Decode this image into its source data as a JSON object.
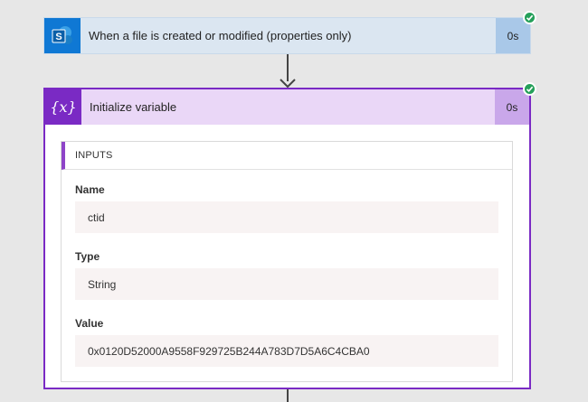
{
  "steps": [
    {
      "title": "When a file is created or modified (properties only)",
      "duration": "0s",
      "icon": "sharepoint-icon",
      "status": "succeeded"
    },
    {
      "title": "Initialize variable",
      "duration": "0s",
      "icon": "variable-icon",
      "status": "succeeded",
      "inputs": {
        "heading": "INPUTS",
        "fields": [
          {
            "label": "Name",
            "value": "ctid"
          },
          {
            "label": "Type",
            "value": "String"
          },
          {
            "label": "Value",
            "value": "0x0120D52000A9558F929725B244A783D7D5A6C4CBA0"
          }
        ]
      }
    }
  ],
  "colors": {
    "sharepoint_accent": "#0f78d4",
    "variable_accent": "#7a2ac4",
    "success": "#25a05a"
  }
}
